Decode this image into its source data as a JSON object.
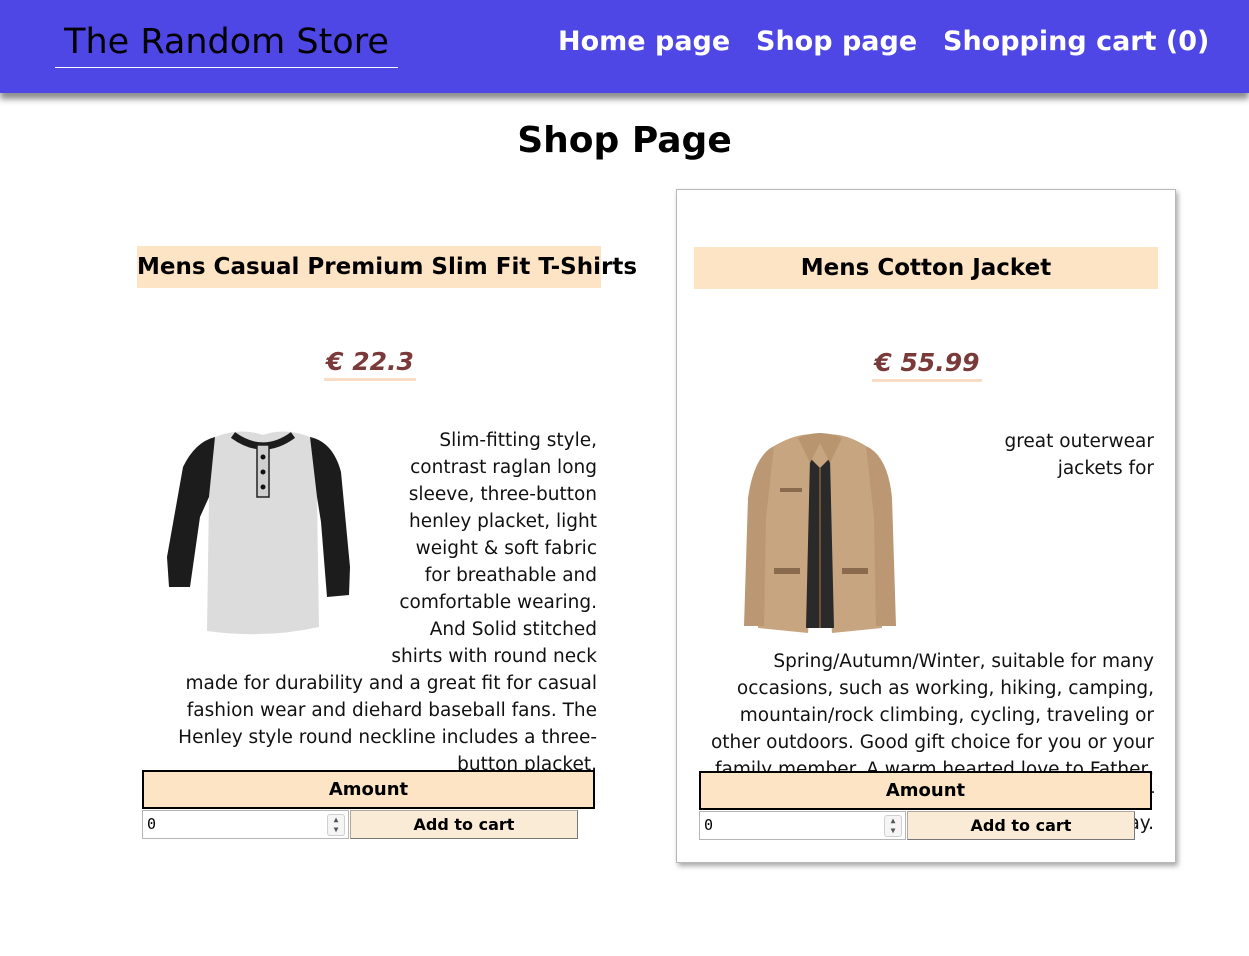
{
  "header": {
    "brand": "The Random Store",
    "nav": {
      "home": "Home page",
      "shop": "Shop page",
      "cart": "Shopping cart (0)"
    },
    "accent_color": "#4e46e5"
  },
  "page": {
    "title": "Shop Page"
  },
  "products": [
    {
      "title": "Mens Casual Premium Slim Fit T-Shirts",
      "price": "€ 22.3",
      "description": "Slim-fitting style, contrast raglan long sleeve, three-button henley placket, light weight & soft fabric for breathable and comfortable wearing. And Solid stitched shirts with round neck made for durability and a great fit for casual fashion wear and diehard baseball fans. The Henley style round neckline includes a three-button placket.",
      "image_icon": "raglan-tshirt",
      "amount_label": "Amount",
      "amount_value": "0",
      "add_label": "Add to cart"
    },
    {
      "title": "Mens Cotton Jacket",
      "price": "€ 55.99",
      "description": "great outerwear jackets for Spring/Autumn/Winter, suitable for many occasions, such as working, hiking, camping, mountain/rock climbing, cycling, traveling or other outdoors. Good gift choice for you or your family member. A warm hearted love to Father, husband or son in this thanksgiving or Christmas Day.",
      "image_icon": "cotton-jacket",
      "amount_label": "Amount",
      "amount_value": "0",
      "add_label": "Add to cart"
    }
  ],
  "colors": {
    "title_bg": "#fde4c4",
    "price_text": "#7a3a3a",
    "button_bg": "#faebd6"
  }
}
